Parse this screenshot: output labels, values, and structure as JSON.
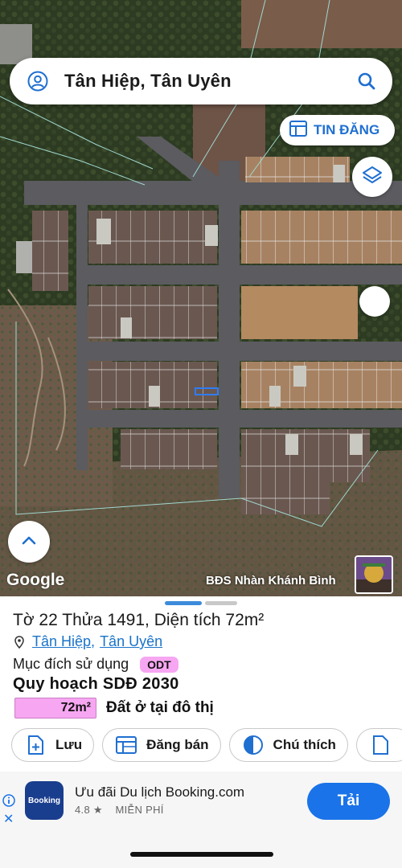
{
  "search": {
    "query": "Tân Hiệp, Tân Uyên"
  },
  "map": {
    "listing_button_label": "TIN ĐĂNG",
    "google_logo": "Google",
    "attribution": "BĐS Nhàn Khánh Bình"
  },
  "parcel": {
    "title": "Tờ 22 Thửa 1491, Diện tích 72m²",
    "location": {
      "commune": "Tân Hiệp",
      "separator": ",",
      "district": "Tân Uyên"
    },
    "purpose_label": "Mục đích sử dụng",
    "purpose_code": "ODT",
    "plan_title": "Quy hoạch SDĐ 2030",
    "plan_area": "72m²",
    "plan_use": "Đất ở tại đô thị"
  },
  "actions": [
    {
      "label": "Lưu",
      "icon": "save-icon"
    },
    {
      "label": "Đăng bán",
      "icon": "listing-icon"
    },
    {
      "label": "Chú thích",
      "icon": "legend-icon"
    }
  ],
  "ad": {
    "app_icon_text": "Booking",
    "app_name": "Ưu đãi Du lịch Booking.com",
    "rating": "4.8 ★",
    "price": "MIỄN PHÍ",
    "install_label": "Tải"
  },
  "colors": {
    "accent_blue": "#1a73e8",
    "zoning_pink": "#f7a6f2",
    "link_blue": "#1a73c9"
  }
}
